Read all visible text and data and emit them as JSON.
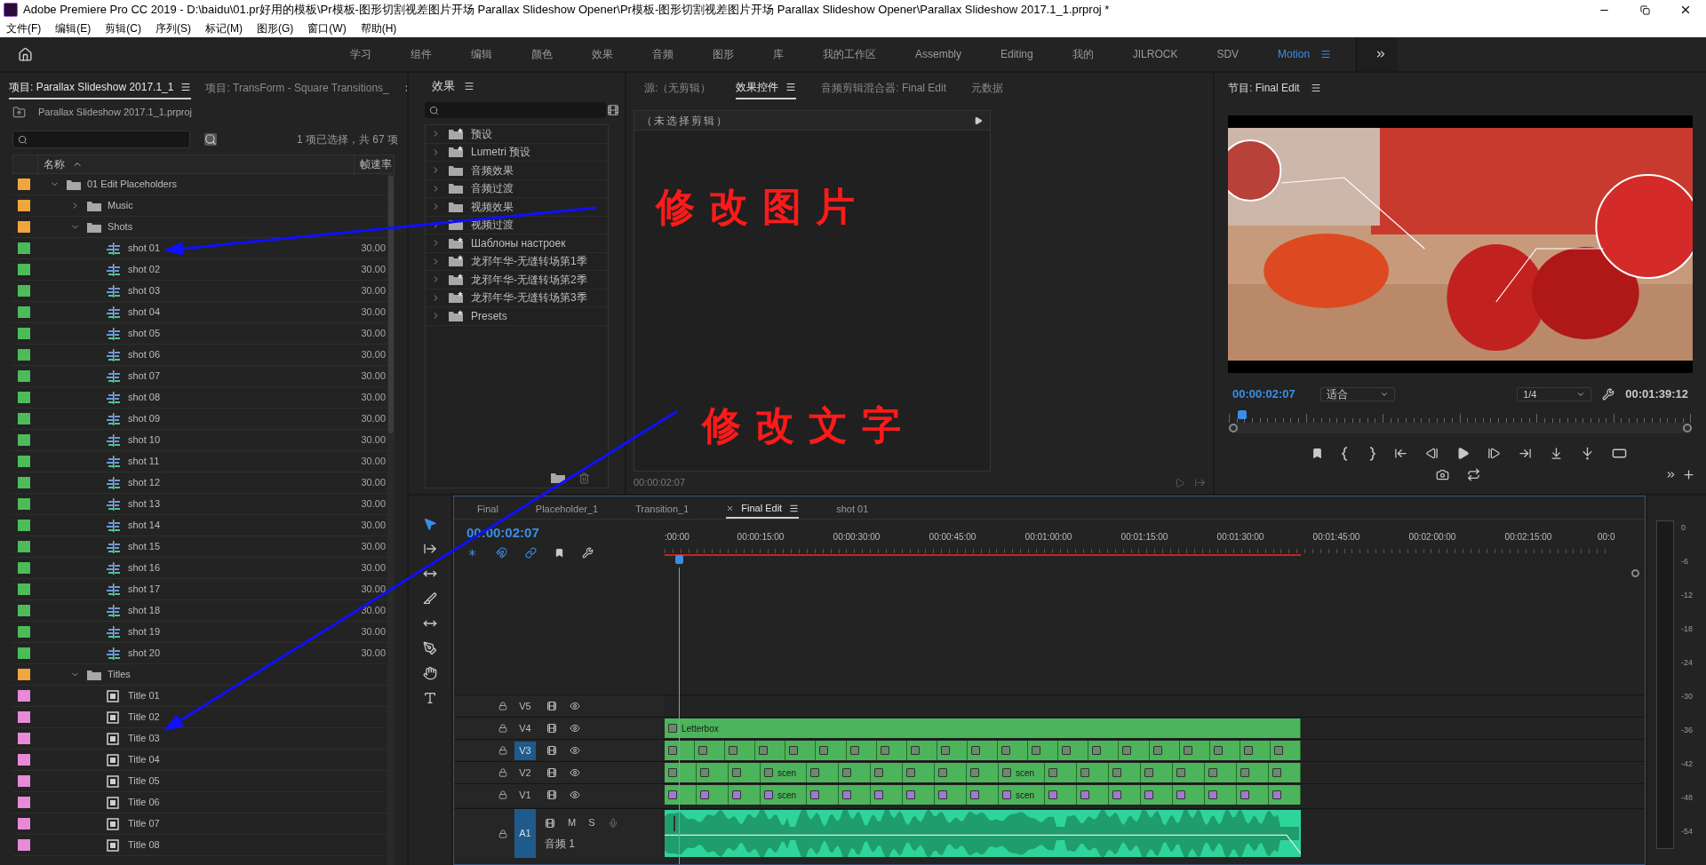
{
  "window": {
    "title": "Adobe Premiere Pro CC 2019 - D:\\baidu\\01.pr好用的模板\\Pr模板-图形切割视差图片开场 Parallax Slideshow Opener\\Pr模板-图形切割视差图片开场 Parallax Slideshow Opener\\Parallax Slideshow 2017.1_1.prproj *"
  },
  "menu_bar": [
    "文件(F)",
    "编辑(E)",
    "剪辑(C)",
    "序列(S)",
    "标记(M)",
    "图形(G)",
    "窗口(W)",
    "帮助(H)"
  ],
  "workspaces": [
    {
      "label": "学习",
      "selected": false
    },
    {
      "label": "组件",
      "selected": false
    },
    {
      "label": "编辑",
      "selected": false
    },
    {
      "label": "颜色",
      "selected": false
    },
    {
      "label": "效果",
      "selected": false
    },
    {
      "label": "音频",
      "selected": false
    },
    {
      "label": "图形",
      "selected": false
    },
    {
      "label": "库",
      "selected": false
    },
    {
      "label": "我的工作区",
      "selected": false
    },
    {
      "label": "Assembly",
      "selected": false
    },
    {
      "label": "Editing",
      "selected": false
    },
    {
      "label": "我的",
      "selected": false
    },
    {
      "label": "JILROCK",
      "selected": false
    },
    {
      "label": "SDV",
      "selected": false
    },
    {
      "label": "Motion",
      "selected": true
    }
  ],
  "project_panel": {
    "tabs": [
      {
        "label": "项目: Parallax Slideshow 2017.1_1",
        "selected": true
      },
      {
        "label": "项目: TransForm - Square Transitions_",
        "selected": false
      }
    ],
    "file_name": "Parallax Slideshow 2017.1_1.prproj",
    "selection_count": "1 项已选择，共 67 项",
    "columns": [
      "名称",
      "帧速率"
    ],
    "items": [
      {
        "name": "01 Edit Placeholders",
        "kind": "bin",
        "color": "#f0a63c",
        "expanded": true,
        "children": [
          {
            "name": "Music",
            "kind": "bin",
            "color": "#f0a63c",
            "expanded": false
          },
          {
            "name": "Shots",
            "kind": "bin",
            "color": "#f0a63c",
            "expanded": true,
            "children": [
              {
                "name": "shot 01",
                "kind": "sequence",
                "color": "#4cbb5a",
                "frame_rate": "30.00"
              },
              {
                "name": "shot 02",
                "kind": "sequence",
                "color": "#4cbb5a",
                "frame_rate": "30.00"
              },
              {
                "name": "shot 03",
                "kind": "sequence",
                "color": "#4cbb5a",
                "frame_rate": "30.00"
              },
              {
                "name": "shot 04",
                "kind": "sequence",
                "color": "#4cbb5a",
                "frame_rate": "30.00"
              },
              {
                "name": "shot 05",
                "kind": "sequence",
                "color": "#4cbb5a",
                "frame_rate": "30.00"
              },
              {
                "name": "shot 06",
                "kind": "sequence",
                "color": "#4cbb5a",
                "frame_rate": "30.00"
              },
              {
                "name": "shot 07",
                "kind": "sequence",
                "color": "#4cbb5a",
                "frame_rate": "30.00"
              },
              {
                "name": "shot 08",
                "kind": "sequence",
                "color": "#4cbb5a",
                "frame_rate": "30.00"
              },
              {
                "name": "shot 09",
                "kind": "sequence",
                "color": "#4cbb5a",
                "frame_rate": "30.00"
              },
              {
                "name": "shot 10",
                "kind": "sequence",
                "color": "#4cbb5a",
                "frame_rate": "30.00"
              },
              {
                "name": "shot 11",
                "kind": "sequence",
                "color": "#4cbb5a",
                "frame_rate": "30.00"
              },
              {
                "name": "shot 12",
                "kind": "sequence",
                "color": "#4cbb5a",
                "frame_rate": "30.00"
              },
              {
                "name": "shot 13",
                "kind": "sequence",
                "color": "#4cbb5a",
                "frame_rate": "30.00"
              },
              {
                "name": "shot 14",
                "kind": "sequence",
                "color": "#4cbb5a",
                "frame_rate": "30.00"
              },
              {
                "name": "shot 15",
                "kind": "sequence",
                "color": "#4cbb5a",
                "frame_rate": "30.00"
              },
              {
                "name": "shot 16",
                "kind": "sequence",
                "color": "#4cbb5a",
                "frame_rate": "30.00"
              },
              {
                "name": "shot 17",
                "kind": "sequence",
                "color": "#4cbb5a",
                "frame_rate": "30.00"
              },
              {
                "name": "shot 18",
                "kind": "sequence",
                "color": "#4cbb5a",
                "frame_rate": "30.00"
              },
              {
                "name": "shot 19",
                "kind": "sequence",
                "color": "#4cbb5a",
                "frame_rate": "30.00"
              },
              {
                "name": "shot 20",
                "kind": "sequence",
                "color": "#4cbb5a",
                "frame_rate": "30.00"
              }
            ]
          },
          {
            "name": "Titles",
            "kind": "bin",
            "color": "#f0a63c",
            "expanded": true,
            "children": [
              {
                "name": "Title 01",
                "kind": "graphic",
                "color": "#e88ad8"
              },
              {
                "name": "Title 02",
                "kind": "graphic",
                "color": "#e88ad8"
              },
              {
                "name": "Title 03",
                "kind": "graphic",
                "color": "#e88ad8"
              },
              {
                "name": "Title 04",
                "kind": "graphic",
                "color": "#e88ad8"
              },
              {
                "name": "Title 05",
                "kind": "graphic",
                "color": "#e88ad8"
              },
              {
                "name": "Title 06",
                "kind": "graphic",
                "color": "#e88ad8"
              },
              {
                "name": "Title 07",
                "kind": "graphic",
                "color": "#e88ad8"
              },
              {
                "name": "Title 08",
                "kind": "graphic",
                "color": "#e88ad8"
              }
            ]
          }
        ]
      }
    ]
  },
  "effects_panel": {
    "title": "效果",
    "items": [
      {
        "name": "预设",
        "kind": "preset_bin"
      },
      {
        "name": "Lumetri 预设",
        "kind": "preset_bin"
      },
      {
        "name": "音频效果",
        "kind": "bin"
      },
      {
        "name": "音频过渡",
        "kind": "bin"
      },
      {
        "name": "视频效果",
        "kind": "bin"
      },
      {
        "name": "视频过渡",
        "kind": "bin"
      },
      {
        "name": "Шаблоны настроек",
        "kind": "preset_bin"
      },
      {
        "name": "龙邪年华-无缝转场第1季",
        "kind": "preset_bin"
      },
      {
        "name": "龙邪年华-无缝转场第2季",
        "kind": "preset_bin"
      },
      {
        "name": "龙邪年华-无缝转场第3季",
        "kind": "preset_bin"
      },
      {
        "name": "Presets",
        "kind": "preset_bin"
      }
    ]
  },
  "effect_controls": {
    "tabs": [
      {
        "label": "源:（无剪辑）",
        "selected": false
      },
      {
        "label": "效果控件",
        "selected": true
      },
      {
        "label": "音频剪辑混合器: Final Edit",
        "selected": false
      },
      {
        "label": "元数据",
        "selected": false
      }
    ],
    "clip_header": "（未选择剪辑）",
    "timecode": "00:00:02:07"
  },
  "program_monitor": {
    "title": "节目: Final Edit",
    "timecode": "00:00:02:07",
    "zoom": "适合",
    "resolution": "1/4",
    "duration": "00:01:39:12",
    "scrubber": {
      "level": 0.02
    }
  },
  "timeline": {
    "tabs": [
      {
        "label": "Final",
        "selected": false,
        "closable": false
      },
      {
        "label": "Placeholder_1",
        "selected": false,
        "closable": false
      },
      {
        "label": "Transition_1",
        "selected": false,
        "closable": false
      },
      {
        "label": "Final Edit",
        "selected": true,
        "closable": true
      },
      {
        "label": "shot 01",
        "selected": false,
        "closable": false
      }
    ],
    "timecode": "00:00:02:07",
    "playhead": {
      "level": 0.015
    },
    "ruler_labels": [
      ":00:00",
      "00:00:15:00",
      "00:00:30:00",
      "00:00:45:00",
      "00:01:00:00",
      "00:01:15:00",
      "00:01:30:00",
      "00:01:45:00",
      "00:02:00:00",
      "00:02:15:00",
      "00:0"
    ],
    "tracks": [
      {
        "name": "V5",
        "kind": "video",
        "targeted": false
      },
      {
        "name": "V4",
        "kind": "video",
        "targeted": false,
        "clips": [
          {
            "kind": "named",
            "label": "Letterbox"
          }
        ]
      },
      {
        "name": "V3",
        "kind": "video",
        "targeted": true,
        "clips": [
          {
            "kind": "plain"
          },
          {
            "kind": "plain"
          },
          {
            "kind": "plain"
          },
          {
            "kind": "plain"
          },
          {
            "kind": "plain"
          },
          {
            "kind": "plain"
          },
          {
            "kind": "plain"
          },
          {
            "kind": "plain"
          },
          {
            "kind": "plain"
          },
          {
            "kind": "plain"
          },
          {
            "kind": "plain"
          },
          {
            "kind": "plain"
          },
          {
            "kind": "plain"
          },
          {
            "kind": "plain"
          },
          {
            "kind": "plain"
          },
          {
            "kind": "plain"
          },
          {
            "kind": "plain"
          },
          {
            "kind": "plain"
          },
          {
            "kind": "plain"
          },
          {
            "kind": "plain"
          },
          {
            "kind": "plain"
          }
        ]
      },
      {
        "name": "V2",
        "kind": "video",
        "targeted": false,
        "clips": [
          {
            "kind": "plain"
          },
          {
            "kind": "plain"
          },
          {
            "kind": "plain"
          },
          {
            "kind": "named",
            "label": "scen"
          },
          {
            "kind": "plain"
          },
          {
            "kind": "plain"
          },
          {
            "kind": "plain"
          },
          {
            "kind": "plain"
          },
          {
            "kind": "plain"
          },
          {
            "kind": "plain"
          },
          {
            "kind": "named",
            "label": "scen"
          },
          {
            "kind": "plain"
          },
          {
            "kind": "plain"
          },
          {
            "kind": "plain"
          },
          {
            "kind": "plain"
          },
          {
            "kind": "plain"
          },
          {
            "kind": "plain"
          },
          {
            "kind": "plain"
          },
          {
            "kind": "plain"
          }
        ]
      },
      {
        "name": "V1",
        "kind": "video",
        "targeted": false,
        "clips": [
          {
            "kind": "plain"
          },
          {
            "kind": "plain"
          },
          {
            "kind": "plain"
          },
          {
            "kind": "named",
            "label": "scen"
          },
          {
            "kind": "plain"
          },
          {
            "kind": "plain"
          },
          {
            "kind": "plain"
          },
          {
            "kind": "plain"
          },
          {
            "kind": "plain"
          },
          {
            "kind": "plain"
          },
          {
            "kind": "named",
            "label": "scen"
          },
          {
            "kind": "plain"
          },
          {
            "kind": "plain"
          },
          {
            "kind": "plain"
          },
          {
            "kind": "plain"
          },
          {
            "kind": "plain"
          },
          {
            "kind": "plain"
          },
          {
            "kind": "plain"
          },
          {
            "kind": "plain"
          }
        ]
      },
      {
        "name": "A1",
        "kind": "audio",
        "targeted": true,
        "label": "音频 1",
        "mute": "M",
        "solo": "S"
      }
    ]
  },
  "meter_scale": [
    "0",
    "-6",
    "-12",
    "-18",
    "-24",
    "-30",
    "-36",
    "-42",
    "-48",
    "-54"
  ],
  "annotations": [
    {
      "text": "修改图片"
    },
    {
      "text": "修改文字"
    }
  ]
}
